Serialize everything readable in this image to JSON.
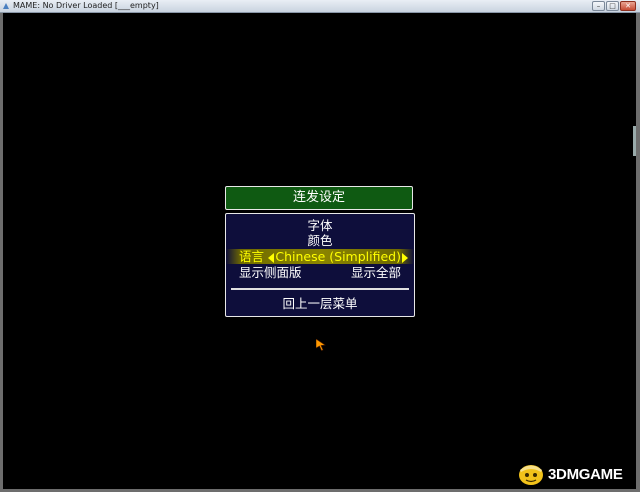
{
  "window": {
    "title": "MAME: No Driver Loaded [___empty]",
    "buttons": {
      "minimize": "–",
      "maximize": "□",
      "close": "✕"
    }
  },
  "menu": {
    "title": "连发设定",
    "items": [
      {
        "label": "字体"
      },
      {
        "label": "颜色"
      },
      {
        "label": "语言",
        "value": "Chinese (Simplified)",
        "selected": true
      },
      {
        "label": "显示侧面版",
        "value": "显示全部"
      }
    ],
    "back_label": "回上一层菜单"
  },
  "watermark": {
    "text": "3DMGAME"
  },
  "colors": {
    "menu_title_bg": "#0f5a12",
    "menu_bg": "#0e0e3b",
    "selected_text": "#ffff00",
    "cursor": "#ff9900"
  }
}
